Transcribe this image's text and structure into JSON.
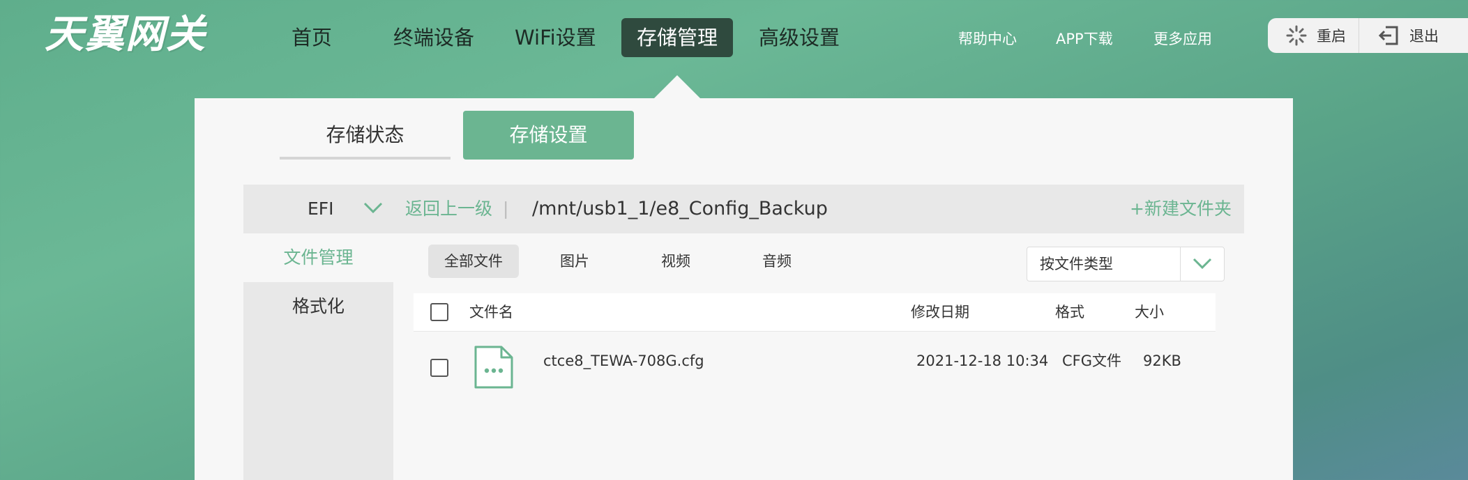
{
  "brand": {
    "logo_text": "天翼网关"
  },
  "nav": {
    "items": [
      {
        "label": "首页"
      },
      {
        "label": "终端设备"
      },
      {
        "label": "WiFi设置"
      },
      {
        "label": "存储管理"
      },
      {
        "label": "高级设置"
      }
    ],
    "active": "存储管理"
  },
  "top_links": {
    "help": "帮助中心",
    "app": "APP下载",
    "more": "更多应用"
  },
  "top_buttons": {
    "restart_label": "重启",
    "restart_icon": "spinner-icon",
    "logout_label": "退出",
    "logout_icon": "logout-icon"
  },
  "subtabs": {
    "status": "存储状态",
    "settings": "存储设置",
    "active": "存储设置"
  },
  "pathbar": {
    "volume": "EFI",
    "back": "返回上一级",
    "separator": "|",
    "path": "/mnt/usb1_1/e8_Config_Backup",
    "new_folder": "+新建文件夹"
  },
  "side_menu": {
    "items": [
      {
        "label": "文件管理"
      },
      {
        "label": "格式化"
      }
    ],
    "active": "文件管理"
  },
  "file_tabs": {
    "items": [
      {
        "label": "全部文件"
      },
      {
        "label": "图片"
      },
      {
        "label": "视频"
      },
      {
        "label": "音频"
      }
    ],
    "active": "全部文件"
  },
  "type_filter": {
    "value": "按文件类型"
  },
  "table": {
    "headers": {
      "name": "文件名",
      "date": "修改日期",
      "format": "格式",
      "size": "大小"
    },
    "rows": [
      {
        "name": "ctce8_TEWA-708G.cfg",
        "date": "2021-12-18 10:34",
        "format": "CFG文件",
        "size": "92KB",
        "icon": "file-icon"
      }
    ]
  },
  "colors": {
    "accent": "#6bb591",
    "nav_active_bg": "#2f4a3e",
    "panel_bg": "#f7f7f7"
  }
}
